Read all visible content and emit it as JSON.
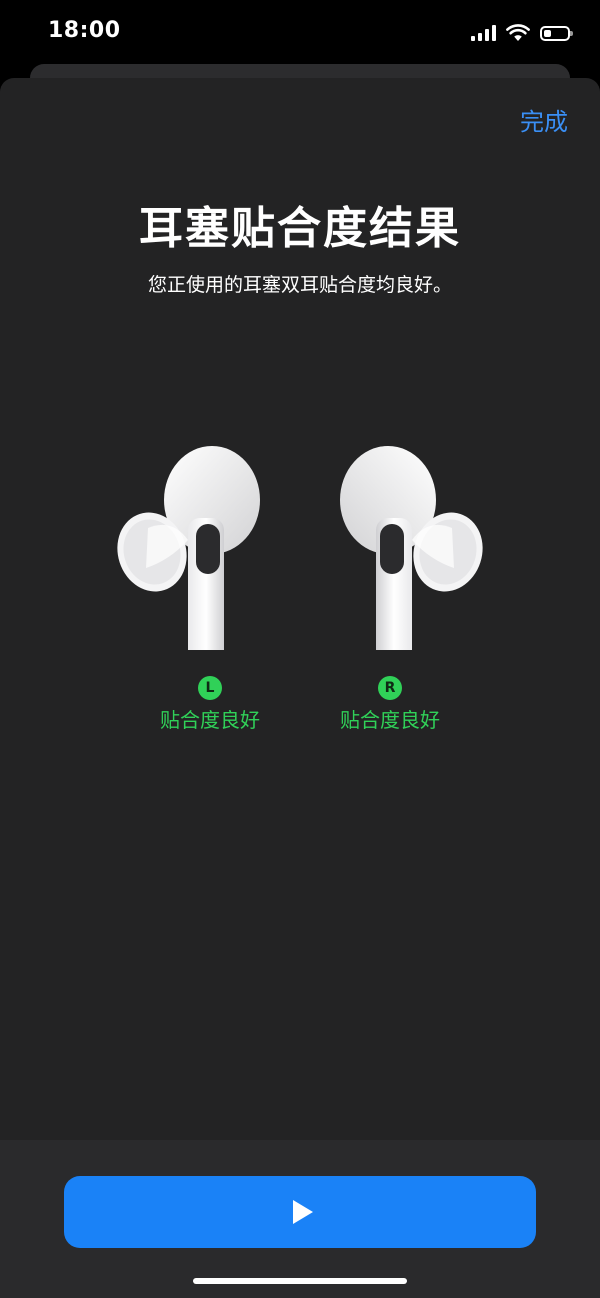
{
  "status_bar": {
    "time": "18:00",
    "icons": [
      "cellular-signal-icon",
      "wifi-icon",
      "battery-icon"
    ],
    "battery_level": 0.3
  },
  "header": {
    "done_label": "完成",
    "title": "耳塞贴合度结果",
    "subtitle": "您正使用的耳塞双耳贴合度均良好。"
  },
  "earbuds": {
    "left": {
      "side": "L",
      "result": "贴合度良好"
    },
    "right": {
      "side": "R",
      "result": "贴合度良好"
    }
  },
  "footer": {
    "play_icon": "play-icon"
  },
  "colors": {
    "accent": "#3a8ff5",
    "button": "#1a82f7",
    "good": "#30d158",
    "sheet": "#232324"
  }
}
